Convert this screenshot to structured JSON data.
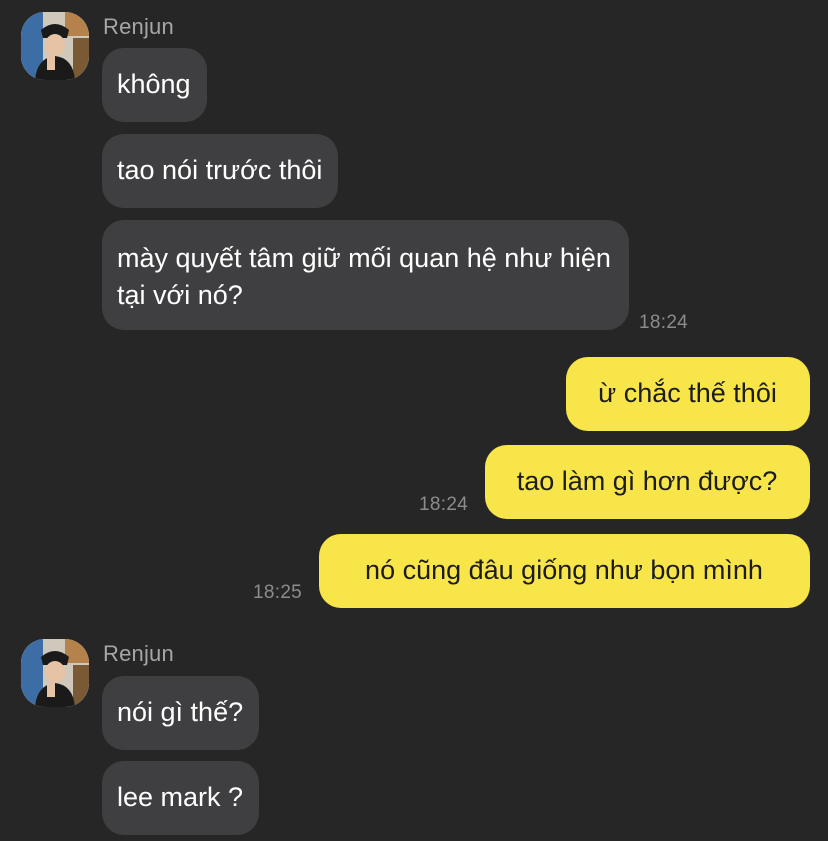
{
  "conversation": {
    "groups": [
      {
        "sender": "Renjun",
        "messages": [
          "không",
          "tao nói trước thôi",
          "mày quyết tâm giữ mối quan hệ như hiện tại với nó?"
        ],
        "time": "18:24"
      },
      {
        "sender": "me",
        "messages": [
          "ừ chắc thế thôi",
          "tao làm gì hơn được?",
          "nó cũng đâu giống như bọn mình"
        ],
        "times": [
          "18:24",
          "18:25"
        ]
      },
      {
        "sender": "Renjun",
        "messages": [
          "nói gì thế?",
          "lee mark ?"
        ]
      }
    ]
  },
  "colors": {
    "background": "#262626",
    "incoming_bubble": "#3f3f41",
    "outgoing_bubble": "#f8e54a",
    "sender_name": "#a6a6a6",
    "timestamp": "#8c8c8c"
  },
  "icons": {
    "avatar": "user-avatar-icon"
  }
}
